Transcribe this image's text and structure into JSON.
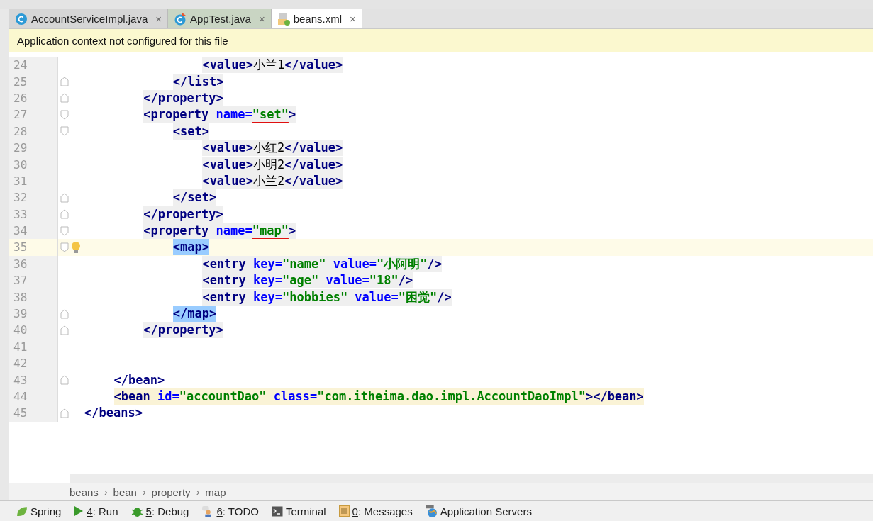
{
  "tabs": [
    {
      "label": "AccountServiceImpl.java",
      "kind": "class",
      "close": "×",
      "selected": false
    },
    {
      "label": "AppTest.java",
      "kind": "test",
      "close": "×",
      "selected": false
    },
    {
      "label": "beans.xml",
      "kind": "xml",
      "close": "×",
      "selected": true
    }
  ],
  "banner": {
    "text": "Application context not configured for this file"
  },
  "editor": {
    "lines": [
      {
        "children": [
          {
            "children": [
              {
                "children": [
                  {
                    "children": [
                      {
                        "num": "24",
                        "kind": "tag",
                        "tokens": [
                          {
                            "kind": "tag",
                            "text": "<value>"
                          },
                          {
                            "kind": "text",
                            "text": "小兰1"
                          },
                          {
                            "kind": "tag",
                            "text": "</value>"
                          }
                        ]
                      }
                    ]
                  },
                  {
                    "num": "25",
                    "kind": "tag",
                    "fold_close": true,
                    "tokens": [
                      {
                        "kind": "tag",
                        "text": "</list>"
                      }
                    ]
                  }
                ]
              },
              {
                "num": "26",
                "kind": "tag",
                "fold_close": true,
                "tokens": [
                  {
                    "kind": "tag",
                    "text": "</property>"
                  }
                ]
              },
              {
                "num": "27",
                "kind": "tag",
                "fold_open": true,
                "tokens": [
                  {
                    "kind": "tag",
                    "text": "<property "
                  },
                  {
                    "kind": "attr",
                    "text": "name="
                  },
                  {
                    "kind": "value",
                    "text": "\"set\"",
                    "underlined": true
                  },
                  {
                    "kind": "tag",
                    "text": ">"
                  }
                ],
                "children": [
                  {
                    "num": "28",
                    "kind": "tag",
                    "fold_open": true,
                    "tokens": [
                      {
                        "kind": "tag",
                        "text": "<set>"
                      }
                    ],
                    "children": [
                      {
                        "num": "29",
                        "kind": "tag",
                        "tokens": [
                          {
                            "kind": "tag",
                            "text": "<value>"
                          },
                          {
                            "kind": "text",
                            "text": "小红2"
                          },
                          {
                            "kind": "tag",
                            "text": "</value>"
                          }
                        ]
                      },
                      {
                        "num": "30",
                        "kind": "tag",
                        "tokens": [
                          {
                            "kind": "tag",
                            "text": "<value>"
                          },
                          {
                            "kind": "text",
                            "text": "小明2"
                          },
                          {
                            "kind": "tag",
                            "text": "</value>"
                          }
                        ]
                      },
                      {
                        "num": "31",
                        "kind": "tag",
                        "tokens": [
                          {
                            "kind": "tag",
                            "text": "<value>"
                          },
                          {
                            "kind": "text",
                            "text": "小兰2"
                          },
                          {
                            "kind": "tag",
                            "text": "</value>"
                          }
                        ]
                      }
                    ]
                  },
                  {
                    "num": "32",
                    "kind": "tag",
                    "fold_close": true,
                    "tokens": [
                      {
                        "kind": "tag",
                        "text": "</set>"
                      }
                    ]
                  }
                ]
              },
              {
                "num": "33",
                "kind": "tag",
                "fold_close": true,
                "tokens": [
                  {
                    "kind": "tag",
                    "text": "</property>"
                  }
                ]
              },
              {
                "num": "34",
                "kind": "tag",
                "fold_open": true,
                "tokens": [
                  {
                    "kind": "tag",
                    "text": "<property "
                  },
                  {
                    "kind": "attr",
                    "text": "name="
                  },
                  {
                    "kind": "value",
                    "text": "\"map\"",
                    "underlined": true
                  },
                  {
                    "kind": "tag",
                    "text": ">"
                  }
                ],
                "children": [
                  {
                    "num": "35",
                    "kind": "match",
                    "fold_open": true,
                    "current": true,
                    "intention": true,
                    "tokens": [
                      {
                        "kind": "tag",
                        "text": "<map>"
                      }
                    ],
                    "children": [
                      {
                        "num": "36",
                        "kind": "tag",
                        "tokens": [
                          {
                            "kind": "tag",
                            "text": "<entry "
                          },
                          {
                            "kind": "attr",
                            "text": "key="
                          },
                          {
                            "kind": "value",
                            "text": "\"name\" "
                          },
                          {
                            "kind": "attr",
                            "text": "value="
                          },
                          {
                            "kind": "value",
                            "text": "\"小阿明\""
                          },
                          {
                            "kind": "tag",
                            "text": "/>"
                          }
                        ]
                      },
                      {
                        "num": "37",
                        "kind": "tag",
                        "tokens": [
                          {
                            "kind": "tag",
                            "text": "<entry "
                          },
                          {
                            "kind": "attr",
                            "text": "key="
                          },
                          {
                            "kind": "value",
                            "text": "\"age\" "
                          },
                          {
                            "kind": "attr",
                            "text": "value="
                          },
                          {
                            "kind": "value",
                            "text": "\"18\""
                          },
                          {
                            "kind": "tag",
                            "text": "/>"
                          }
                        ]
                      },
                      {
                        "num": "38",
                        "kind": "tag",
                        "tokens": [
                          {
                            "kind": "tag",
                            "text": "<entry "
                          },
                          {
                            "kind": "attr",
                            "text": "key="
                          },
                          {
                            "kind": "value",
                            "text": "\"hobbies\" "
                          },
                          {
                            "kind": "attr",
                            "text": "value="
                          },
                          {
                            "kind": "value",
                            "text": "\"困觉\""
                          },
                          {
                            "kind": "tag",
                            "text": "/>"
                          }
                        ]
                      }
                    ]
                  },
                  {
                    "num": "39",
                    "kind": "match",
                    "fold_close": true,
                    "tokens": [
                      {
                        "kind": "tag",
                        "text": "</map>"
                      }
                    ]
                  }
                ]
              },
              {
                "num": "40",
                "kind": "tag",
                "fold_close": true,
                "tokens": [
                  {
                    "kind": "tag",
                    "text": "</property>"
                  }
                ]
              }
            ]
          },
          {
            "num": "41"
          },
          {
            "num": "42"
          },
          {
            "num": "43",
            "fold_close": true,
            "tokens": [
              {
                "kind": "tag",
                "text": "</bean>"
              }
            ]
          },
          {
            "num": "44",
            "kind": "warning",
            "tokens": [
              {
                "kind": "tag",
                "text": "<bean "
              },
              {
                "kind": "attr",
                "text": "id="
              },
              {
                "kind": "value",
                "text": "\"accountDao\" "
              },
              {
                "kind": "attr",
                "text": "class="
              },
              {
                "kind": "value",
                "text": "\"com.itheima.dao.impl.AccountDaoImpl\""
              },
              {
                "kind": "tag",
                "text": "></bean>"
              }
            ]
          }
        ]
      },
      {
        "num": "45",
        "fold_close": true,
        "tokens": [
          {
            "kind": "tag",
            "text": "</beans>"
          }
        ]
      }
    ]
  },
  "breadcrumbs": [
    {
      "label": "beans"
    },
    {
      "separator": "›",
      "label": "bean"
    },
    {
      "separator": "›",
      "label": "property"
    },
    {
      "separator": "›",
      "label": "map"
    }
  ],
  "toolwindows": [
    {
      "kind": "spring",
      "label": "Spring"
    },
    {
      "kind": "run",
      "mnemonic": "4",
      "label": ": Run"
    },
    {
      "kind": "debug",
      "mnemonic": "5",
      "label": ": Debug"
    },
    {
      "kind": "todo",
      "mnemonic": "6",
      "label": ": TODO"
    },
    {
      "kind": "terminal",
      "label": "Terminal"
    },
    {
      "kind": "messages",
      "mnemonic": "0",
      "label": ": Messages"
    },
    {
      "kind": "servers",
      "label": "Application Servers"
    }
  ]
}
